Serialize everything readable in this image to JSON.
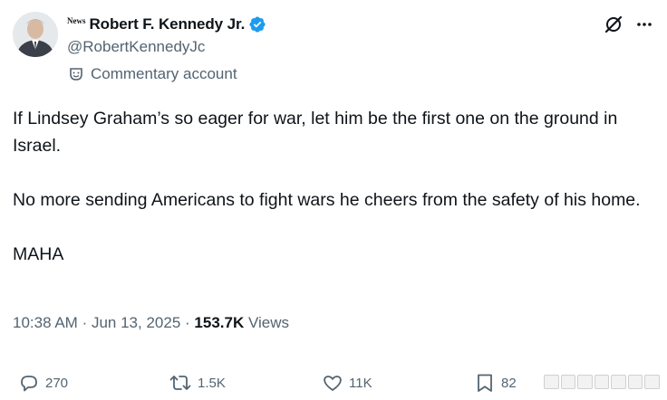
{
  "author": {
    "affiliation_badge": "News",
    "display_name": "Robert F. Kennedy Jr.",
    "handle": "@RobertKennedyJc",
    "account_label": "Commentary account",
    "verified_color": "#1d9bf0"
  },
  "tweet": {
    "paragraphs": [
      "If Lindsey Graham’s so eager for war, let him be the first one on the ground in Israel.",
      "No more sending Americans to fight wars he cheers from the safety of his home.",
      "MAHA"
    ],
    "time": "10:38 AM",
    "separator": "·",
    "date": "Jun 13, 2025",
    "views_count": "153.7K",
    "views_label": "Views"
  },
  "actions": {
    "replies": "270",
    "reposts": "1.5K",
    "likes": "11K",
    "bookmarks": "82"
  },
  "icons": {
    "top": [
      "grok-icon",
      "more-icon"
    ],
    "bar": [
      "reply-icon",
      "repost-icon",
      "like-icon",
      "bookmark-icon"
    ]
  },
  "colors": {
    "text": "#0f1419",
    "secondary": "#536471",
    "brand": "#1d9bf0"
  }
}
